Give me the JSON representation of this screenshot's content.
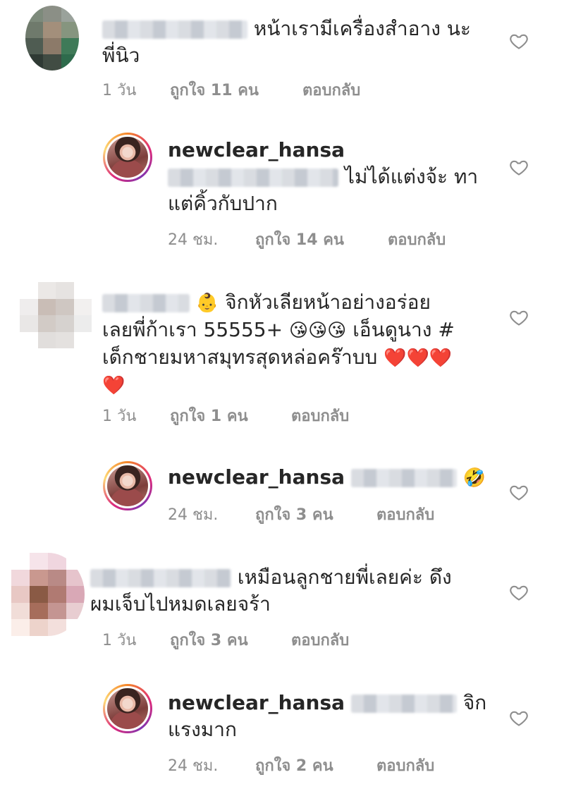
{
  "comments": [
    {
      "text_lines": [
        "หน้าเรามีเครื่องสำอาง นะ",
        "พี่นิว"
      ],
      "time": "1 วัน",
      "likes": "ถูกใจ 11 คน",
      "reply": "ตอบกลับ"
    },
    {
      "username": "newclear_hansa",
      "text_lines": [
        "ไม่ได้แต่งจ้ะ ทา",
        "แต่คิ้วกับปาก"
      ],
      "time": "24 ชม.",
      "likes": "ถูกใจ 14 คน",
      "reply": "ตอบกลับ"
    },
    {
      "text_lines": [
        "จิกหัวเลียหน้าอย่างอร่อย",
        "เลยพี่ก้าเรา 55555+",
        "เอ็นดูนาง #",
        "เด็กชายมหาสมุทรสุดหล่อคร๊าบบ"
      ],
      "emoji": [
        "👶",
        "😘",
        "😘",
        "😘",
        "❤️",
        "❤️",
        "❤️",
        "❤️"
      ],
      "time": "1 วัน",
      "likes": "ถูกใจ 1 คน",
      "reply": "ตอบกลับ"
    },
    {
      "username": "newclear_hansa",
      "emoji": [
        "🤣"
      ],
      "time": "24 ชม.",
      "likes": "ถูกใจ 3 คน",
      "reply": "ตอบกลับ"
    },
    {
      "text_lines": [
        "เหมือนลูกชายพี่เลยค่ะ ดึง",
        "ผมเจ็บไปหมดเลยจร้า"
      ],
      "time": "1 วัน",
      "likes": "ถูกใจ 3 คน",
      "reply": "ตอบกลับ"
    },
    {
      "username": "newclear_hansa",
      "text_lines": [
        "จิก",
        "แรงมาก"
      ],
      "time": "24 ชม.",
      "likes": "ถูกใจ 2 คน",
      "reply": "ตอบกลับ"
    }
  ],
  "icons": {
    "like": "heart-outline-icon"
  },
  "colors": {
    "text": "#262626",
    "meta": "#8e8e8e",
    "heart_outline": "#8e8e8e"
  }
}
